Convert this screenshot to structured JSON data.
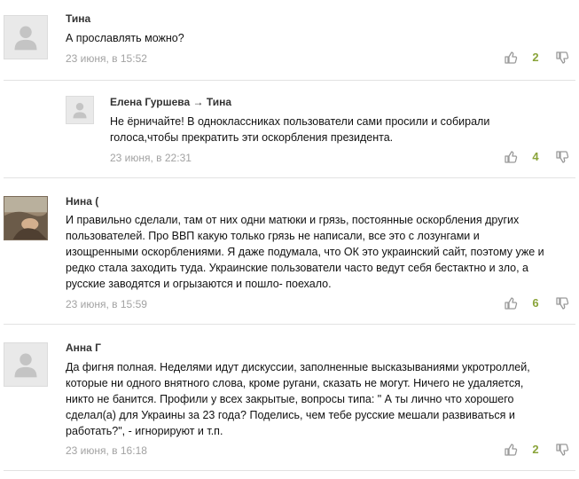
{
  "comments": [
    {
      "author": "Тина",
      "text": [
        "А прославлять можно?"
      ],
      "date": "23 июня, в 15:52",
      "likes": "2"
    },
    {
      "author": "Елена Гуршева",
      "reply_to": "Тина",
      "arrow": "→",
      "text": [
        "Не ёрничайте! В одноклассниках пользователи сами просили и собирали",
        "голоса,чтобы прекратить эти оскорбления президента."
      ],
      "date": "23 июня, в 22:31",
      "likes": "4"
    },
    {
      "author": "Нина (",
      "text": [
        "И правильно сделали, там от них одни матюки и грязь, постоянные оскорбления других",
        "пользователей. Про ВВП какую только грязь не написали, все это с лозунгами и",
        "изощренными оскорблениями. Я даже подумала, что ОК это украинский сайт, поэтому уже и",
        "редко стала заходить туда. Украинские пользователи часто ведут себя бестактно и зло, а",
        "русские заводятся и огрызаются и пошло- поехало."
      ],
      "date": "23 июня, в 15:59",
      "likes": "6"
    },
    {
      "author": "Анна Г",
      "text": [
        "Да фигня полная. Неделями идут дискуссии, заполненные высказываниями укротроллей,",
        "которые ни одного внятного слова, кроме ругани, сказать не могут. Ничего не удаляется,",
        "никто не банится. Профили у всех закрытые, вопросы типа: \" А ты лично что хорошего",
        "сделал(а) для Украины за 23 года? Поделись, чем тебе русские мешали развиваться и",
        "работать?\", - игнорируют и т.п."
      ],
      "date": "23 июня, в 16:18",
      "likes": "2"
    }
  ],
  "icons": {
    "like": "thumbs-up-icon",
    "dislike": "thumbs-down-icon",
    "avatar_placeholder": "user-silhouette-icon"
  },
  "colors": {
    "likes_count": "#8aa43a",
    "date": "#a2a2a2",
    "divider": "#e2e2e2"
  }
}
